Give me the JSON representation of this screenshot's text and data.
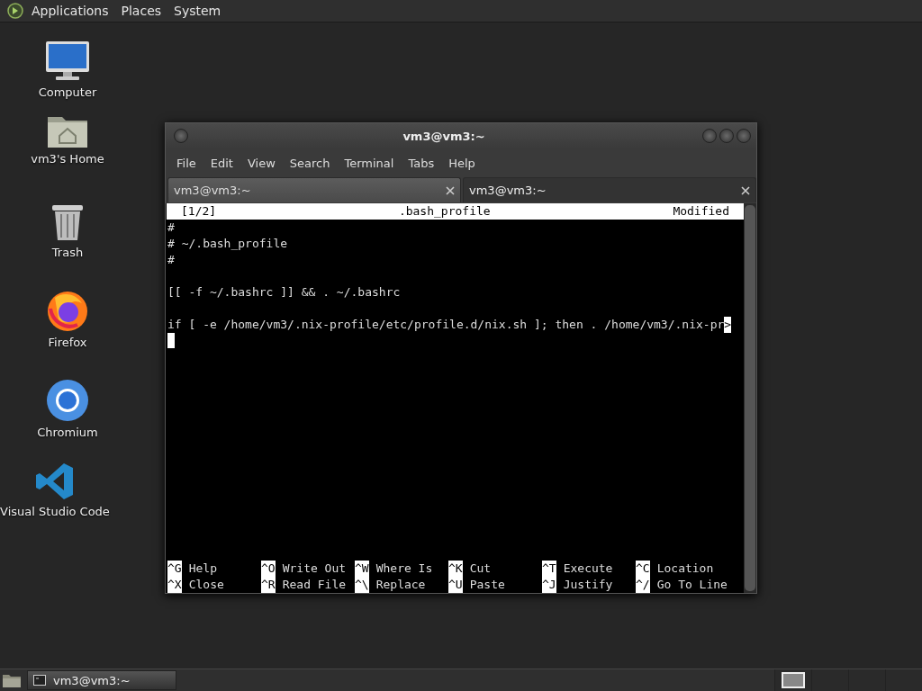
{
  "top_panel": {
    "menus": [
      "Applications",
      "Places",
      "System"
    ]
  },
  "desktop_icons": [
    {
      "kind": "computer",
      "label": "Computer"
    },
    {
      "kind": "home",
      "label": "vm3's Home"
    },
    {
      "kind": "trash",
      "label": "Trash"
    },
    {
      "kind": "firefox",
      "label": "Firefox"
    },
    {
      "kind": "chromium",
      "label": "Chromium"
    },
    {
      "kind": "vscode",
      "label": "Visual Studio Code"
    }
  ],
  "window": {
    "title": "vm3@vm3:~",
    "menu": [
      "File",
      "Edit",
      "View",
      "Search",
      "Terminal",
      "Tabs",
      "Help"
    ],
    "tabs": [
      {
        "label": "vm3@vm3:~",
        "selected": false
      },
      {
        "label": "vm3@vm3:~",
        "selected": true
      }
    ],
    "editor": {
      "header": {
        "buffer": "[1/2]",
        "filename": ".bash_profile",
        "status": "Modified"
      },
      "lines": [
        {
          "kind": "text",
          "text": "#"
        },
        {
          "kind": "text",
          "text": "# ~/.bash_profile"
        },
        {
          "kind": "text",
          "text": "#"
        },
        {
          "kind": "blank"
        },
        {
          "kind": "text",
          "text": "[[ -f ~/.bashrc ]] && . ~/.bashrc"
        },
        {
          "kind": "blank"
        },
        {
          "kind": "text",
          "text": "if [ -e /home/vm3/.nix-profile/etc/profile.d/nix.sh ]; then . /home/vm3/.nix-pr",
          "overflow_marker": ">"
        },
        {
          "kind": "cursor"
        }
      ],
      "shortcuts": [
        [
          {
            "key": "^G",
            "label": "Help"
          },
          {
            "key": "^O",
            "label": "Write Out"
          },
          {
            "key": "^W",
            "label": "Where Is"
          },
          {
            "key": "^K",
            "label": "Cut"
          },
          {
            "key": "^T",
            "label": "Execute"
          },
          {
            "key": "^C",
            "label": "Location"
          }
        ],
        [
          {
            "key": "^X",
            "label": "Close"
          },
          {
            "key": "^R",
            "label": "Read File"
          },
          {
            "key": "^\\",
            "label": "Replace"
          },
          {
            "key": "^U",
            "label": "Paste"
          },
          {
            "key": "^J",
            "label": "Justify"
          },
          {
            "key": "^/",
            "label": "Go To Line"
          }
        ]
      ]
    }
  },
  "taskbar": {
    "tasks": [
      {
        "label": "vm3@vm3:~"
      }
    ],
    "workspaces": [
      {
        "selected": true
      },
      {
        "selected": false
      },
      {
        "selected": false
      },
      {
        "selected": false
      }
    ]
  }
}
